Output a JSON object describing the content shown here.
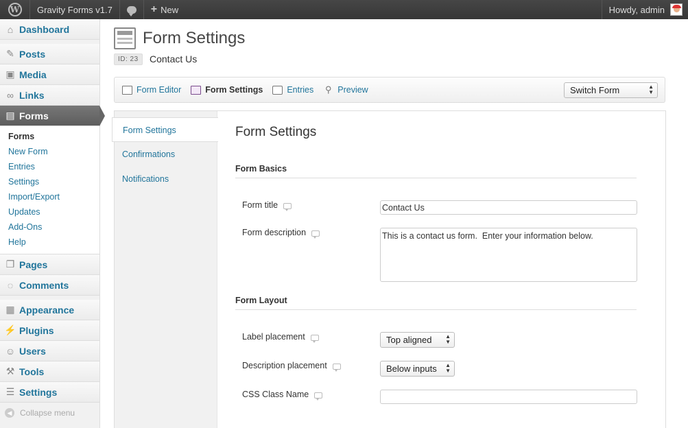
{
  "adminbar": {
    "site_name": "Gravity Forms v1.7",
    "new_label": "New",
    "howdy": "Howdy, admin"
  },
  "sidebar": {
    "items": [
      {
        "label": "Dashboard"
      },
      {
        "label": "Posts"
      },
      {
        "label": "Media"
      },
      {
        "label": "Links"
      },
      {
        "label": "Forms"
      },
      {
        "label": "Pages"
      },
      {
        "label": "Comments"
      },
      {
        "label": "Appearance"
      },
      {
        "label": "Plugins"
      },
      {
        "label": "Users"
      },
      {
        "label": "Tools"
      },
      {
        "label": "Settings"
      }
    ],
    "forms_submenu": [
      "Forms",
      "New Form",
      "Entries",
      "Settings",
      "Import/Export",
      "Updates",
      "Add-Ons",
      "Help"
    ],
    "collapse_label": "Collapse menu"
  },
  "page": {
    "title": "Form Settings",
    "id_badge": "ID: 23",
    "form_name": "Contact Us"
  },
  "toolbar": {
    "form_editor": "Form Editor",
    "form_settings": "Form Settings",
    "entries": "Entries",
    "preview": "Preview",
    "switch_form": "Switch Form"
  },
  "tabs": [
    "Form Settings",
    "Confirmations",
    "Notifications"
  ],
  "main": {
    "heading": "Form Settings",
    "basics_title": "Form Basics",
    "form_title_label": "Form title",
    "form_title_value": "Contact Us",
    "form_desc_label": "Form description",
    "form_desc_value": "This is a contact us form.  Enter your information below.",
    "layout_title": "Form Layout",
    "label_placement_label": "Label placement",
    "label_placement_value": "Top aligned",
    "desc_placement_label": "Description placement",
    "desc_placement_value": "Below inputs",
    "css_class_label": "CSS Class Name",
    "css_class_value": ""
  }
}
